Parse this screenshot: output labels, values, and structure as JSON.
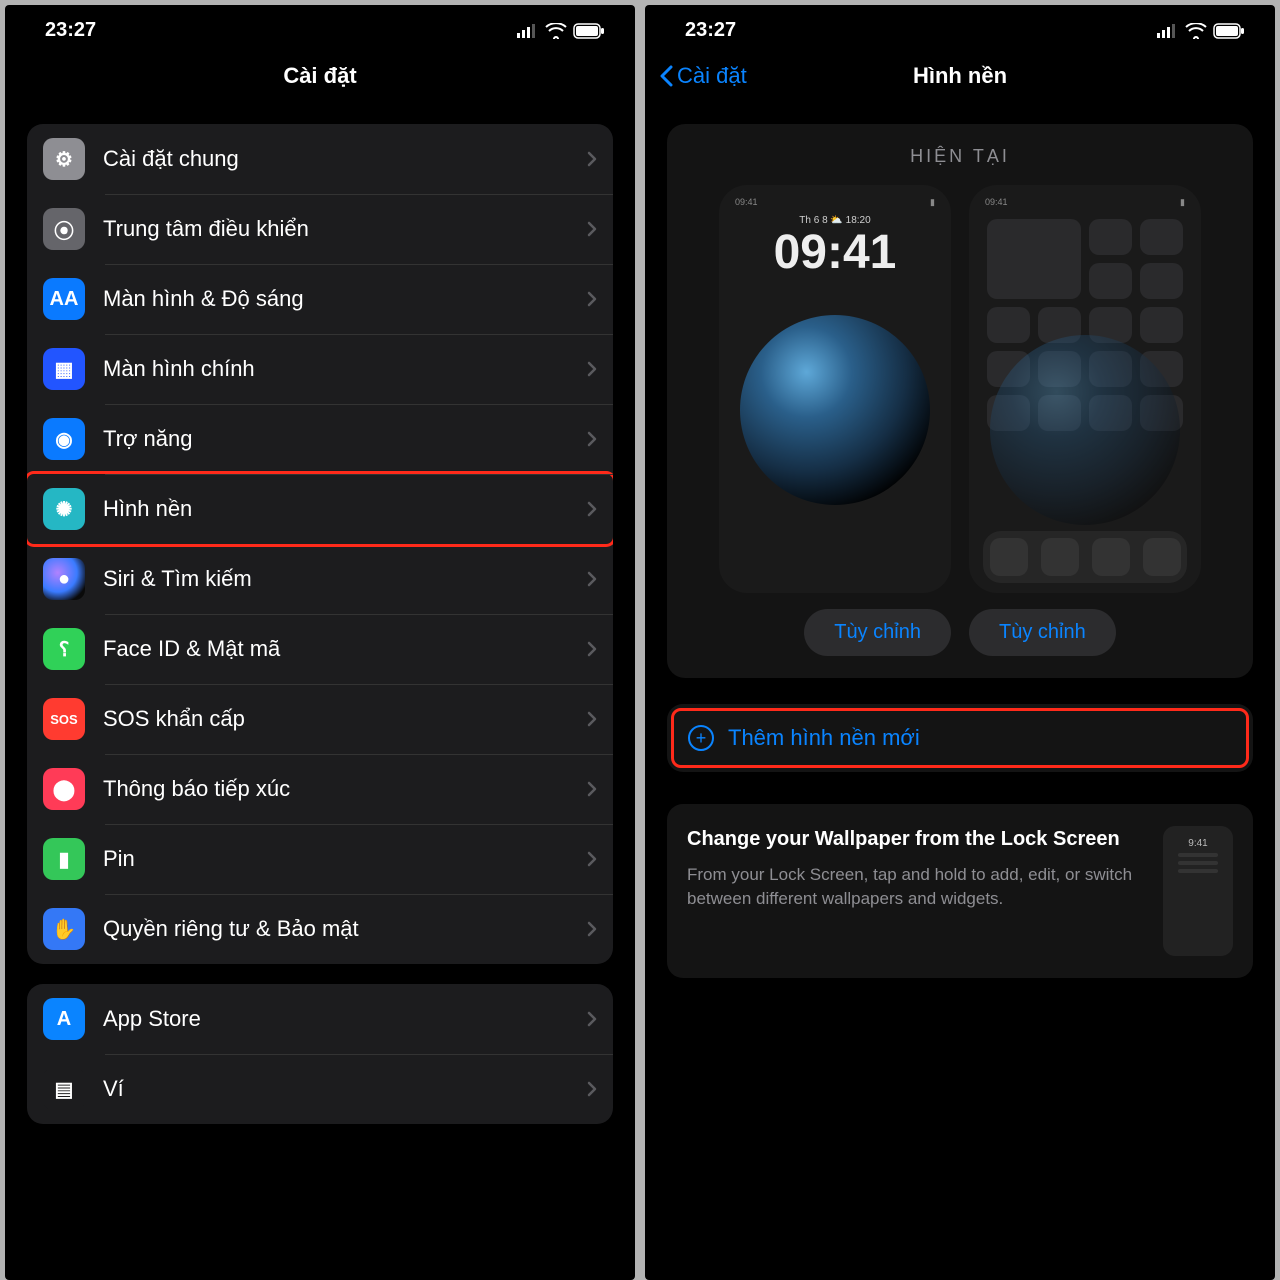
{
  "left": {
    "status_time": "23:27",
    "title": "Cài đặt",
    "groups": [
      [
        {
          "key": "general",
          "label": "Cài đặt chung",
          "icon": "⚙︎",
          "bg": "bg-grey"
        },
        {
          "key": "control-center",
          "label": "Trung tâm điều khiển",
          "icon": "⦿",
          "bg": "bg-grey2"
        },
        {
          "key": "display",
          "label": "Màn hình & Độ sáng",
          "icon": "AA",
          "bg": "bg-blue"
        },
        {
          "key": "home-screen",
          "label": "Màn hình chính",
          "icon": "▦",
          "bg": "bg-bluegrid"
        },
        {
          "key": "accessibility",
          "label": "Trợ năng",
          "icon": "◉",
          "bg": "bg-access"
        },
        {
          "key": "wallpaper",
          "label": "Hình nền",
          "icon": "✺",
          "bg": "bg-teal",
          "highlight": true
        },
        {
          "key": "siri",
          "label": "Siri & Tìm kiếm",
          "icon": "●",
          "bg": "bg-siri"
        },
        {
          "key": "faceid",
          "label": "Face ID & Mật mã",
          "icon": "⸮",
          "bg": "bg-green"
        },
        {
          "key": "sos",
          "label": "SOS khẩn cấp",
          "icon": "SOS",
          "bg": "bg-red"
        },
        {
          "key": "exposure",
          "label": "Thông báo tiếp xúc",
          "icon": "⬤",
          "bg": "bg-pink"
        },
        {
          "key": "battery",
          "label": "Pin",
          "icon": "▮",
          "bg": "bg-green2"
        },
        {
          "key": "privacy",
          "label": "Quyền riêng tư & Bảo mật",
          "icon": "✋",
          "bg": "bg-blue2"
        }
      ],
      [
        {
          "key": "appstore",
          "label": "App Store",
          "icon": "A",
          "bg": "bg-appstore"
        },
        {
          "key": "wallet",
          "label": "Ví",
          "icon": "▤",
          "bg": "bg-wallet"
        }
      ]
    ]
  },
  "right": {
    "status_time": "23:27",
    "back_label": "Cài đặt",
    "title": "Hình nền",
    "current_heading": "HIỆN TẠI",
    "lock_preview": {
      "date_line": "Th 6 8 ⛅ 18:20",
      "time": "09:41",
      "mini_time": "09:41"
    },
    "home_preview": {
      "mini_time": "09:41"
    },
    "customize_label": "Tùy chỉnh",
    "add_label": "Thêm hình nền mới",
    "tip": {
      "title": "Change your Wallpaper from the Lock Screen",
      "desc": "From your Lock Screen, tap and hold to add, edit, or switch between different wallpapers and widgets.",
      "thumb_time": "9:41"
    }
  }
}
